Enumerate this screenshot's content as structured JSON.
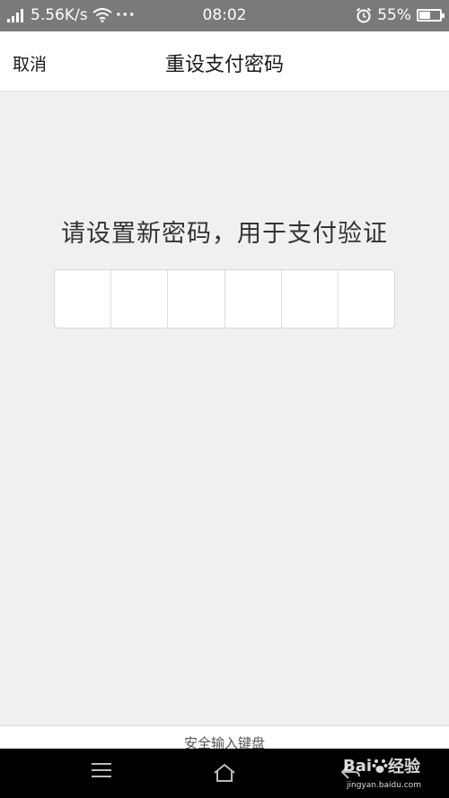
{
  "status_bar": {
    "speed": "5.56K/s",
    "more": "···",
    "time": "08:02",
    "battery_text": "55%",
    "battery_level": 0.55
  },
  "nav": {
    "cancel_label": "取消",
    "title": "重设支付密码"
  },
  "main": {
    "prompt": "请设置新密码，用于支付验证",
    "pin_length": 6
  },
  "keyboard": {
    "label": "安全输入键盘"
  },
  "watermark": {
    "brand": "Bai",
    "brand_cn": "经验",
    "url": "jingyan.baidu.com"
  }
}
